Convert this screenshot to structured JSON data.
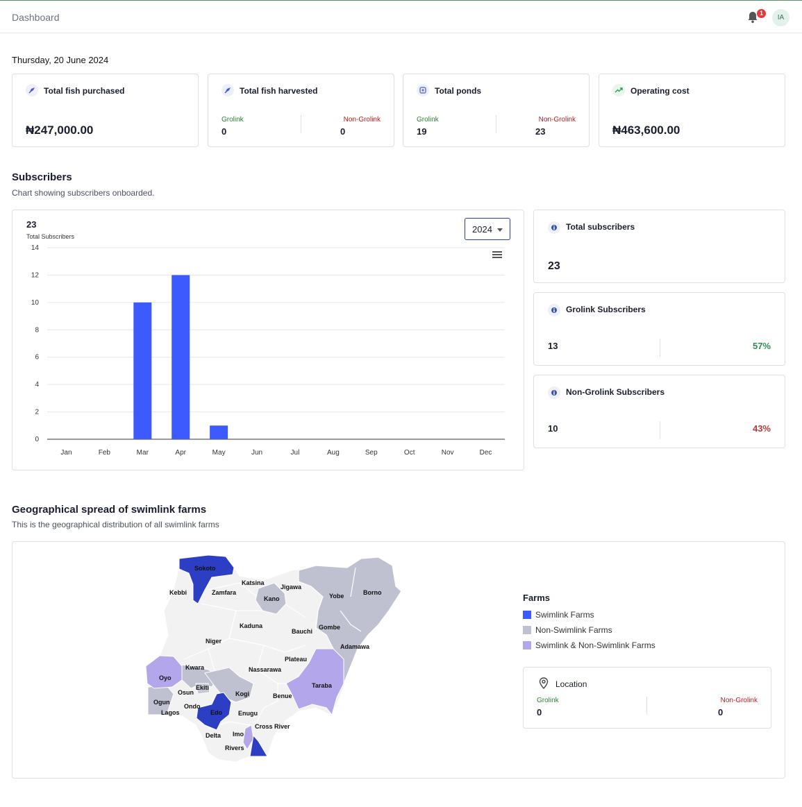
{
  "header": {
    "title": "Dashboard",
    "notification_count": "1",
    "avatar_initials": "IA"
  },
  "date": "Thursday, 20 June 2024",
  "stats": {
    "fish_purchased": {
      "title": "Total fish purchased",
      "value": "₦247,000.00"
    },
    "fish_harvested": {
      "title": "Total fish harvested",
      "left_label": "Grolink",
      "left_value": "0",
      "right_label": "Non-Grolink",
      "right_value": "0"
    },
    "ponds": {
      "title": "Total ponds",
      "left_label": "Grolink",
      "left_value": "19",
      "right_label": "Non-Grolink",
      "right_value": "23"
    },
    "operating_cost": {
      "title": "Operating cost",
      "value": "₦463,600.00"
    }
  },
  "subscribers": {
    "title": "Subscribers",
    "subtitle": "Chart showing subscribers onboarded.",
    "chart_total": "23",
    "chart_total_label": "Total Subscribers",
    "year": "2024",
    "total": {
      "title": "Total subscribers",
      "value": "23"
    },
    "grolink": {
      "title": "Grolink Subscribers",
      "value": "13",
      "percent": "57%"
    },
    "non_grolink": {
      "title": "Non-Grolink Subscribers",
      "value": "10",
      "percent": "43%"
    }
  },
  "chart_data": {
    "type": "bar",
    "categories": [
      "Jan",
      "Feb",
      "Mar",
      "Apr",
      "May",
      "Jun",
      "Jul",
      "Aug",
      "Sep",
      "Oct",
      "Nov",
      "Dec"
    ],
    "values": [
      0,
      0,
      10,
      12,
      1,
      0,
      0,
      0,
      0,
      0,
      0,
      0
    ],
    "ylim": [
      0,
      14
    ],
    "yticks": [
      0,
      2,
      4,
      6,
      8,
      10,
      12,
      14
    ],
    "grid": true,
    "bar_color": "#3d5afe"
  },
  "geo": {
    "title": "Geographical spread of swimlink farms",
    "subtitle": "This is the geographical distribution of all swimlink farms",
    "legend_title": "Farms",
    "legend": [
      {
        "label": "Swimlink Farms",
        "color": "#3d5afe"
      },
      {
        "label": "Non-Swimlink Farms",
        "color": "#bfc1d1"
      },
      {
        "label": "Swimlink & Non-Swimlink Farms",
        "color": "#b3a6ea"
      }
    ],
    "states": [
      "Sokoto",
      "Katsina",
      "Jigawa",
      "Kebbi",
      "Zamfara",
      "Kano",
      "Yobe",
      "Borno",
      "Kaduna",
      "Gombe",
      "Bauchi",
      "Niger",
      "Adamawa",
      "Plateau",
      "Kwara",
      "Nassarawa",
      "Oyo",
      "Taraba",
      "Ekiti",
      "Osun",
      "Kogi",
      "Benue",
      "Ogun",
      "Ondo",
      "Edo",
      "Lagos",
      "Enugu",
      "Cross River",
      "Delta",
      "Imo",
      "Rivers"
    ],
    "location": {
      "title": "Location",
      "left_label": "Grolink",
      "left_value": "0",
      "right_label": "Non-Grolink",
      "right_value": "0"
    }
  }
}
